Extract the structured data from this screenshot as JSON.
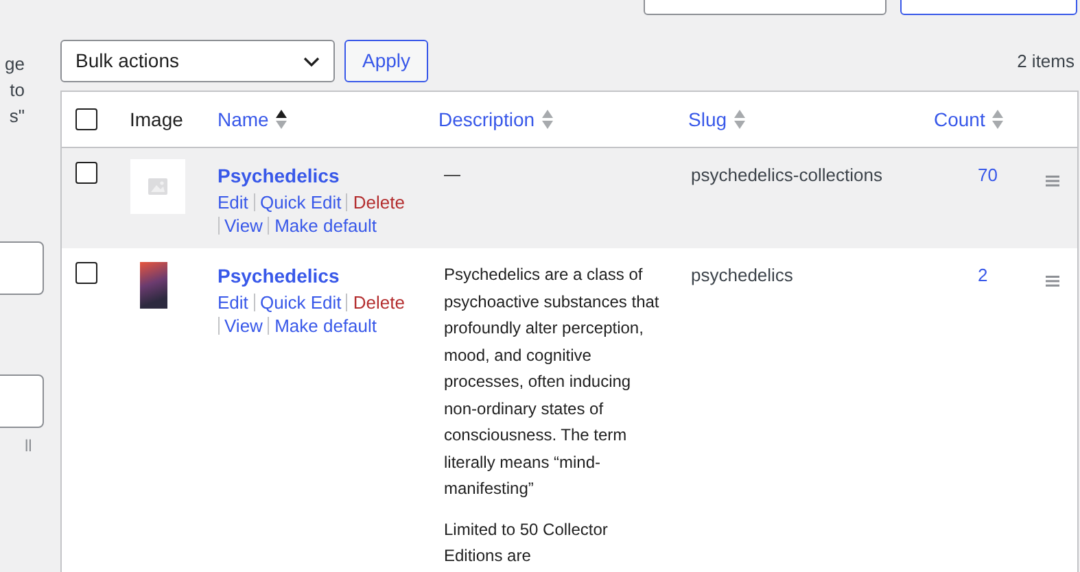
{
  "left_panel": [
    {
      "kind": "text",
      "text": "ge"
    },
    {
      "kind": "text",
      "text": "to"
    },
    {
      "kind": "text",
      "text": "s\""
    },
    {
      "kind": "field"
    },
    {
      "kind": "field"
    },
    {
      "kind": "note",
      "text": "ll"
    }
  ],
  "top_controls": [
    {
      "kind": "field"
    },
    {
      "kind": "button"
    }
  ],
  "toolbar": {
    "bulk_actions": "Bulk actions",
    "apply": "Apply",
    "item_count": "2 items"
  },
  "table": {
    "columns": [
      {
        "kind": "checkbox",
        "checked": false
      },
      {
        "kind": "plain",
        "label": "Image"
      },
      {
        "kind": "sortable",
        "label": "Name",
        "sorted": true
      },
      {
        "kind": "sortable",
        "label": "Description",
        "sorted": false
      },
      {
        "kind": "sortable",
        "label": "Slug",
        "sorted": false
      },
      {
        "kind": "sortable",
        "label": "Count",
        "sorted": false
      },
      {
        "kind": "blank"
      }
    ],
    "rows": [
      {
        "checked": false,
        "highlighted": true,
        "kind": "placeholder",
        "name": "Psychedelics",
        "actions": [
          {
            "label": "Edit",
            "kind": "link"
          },
          {
            "label": "Quick Edit",
            "kind": "link"
          },
          {
            "label": "Delete",
            "kind": "danger"
          },
          {
            "label": "View",
            "kind": "link"
          },
          {
            "label": "Make default",
            "kind": "link"
          }
        ],
        "description": [
          "—"
        ],
        "slug": "psychedelics-collections",
        "count": "70"
      },
      {
        "checked": false,
        "highlighted": false,
        "kind": "photo",
        "name": "Psychedelics",
        "actions": [
          {
            "label": "Edit",
            "kind": "link"
          },
          {
            "label": "Quick Edit",
            "kind": "link"
          },
          {
            "label": "Delete",
            "kind": "danger"
          },
          {
            "label": "View",
            "kind": "link"
          },
          {
            "label": "Make default",
            "kind": "link"
          }
        ],
        "description": [
          "Psychedelics are a class of psychoactive substances that profoundly alter perception, mood, and cognitive processes, often inducing non-ordinary states of consciousness. The term literally means “mind-manifesting”",
          "Limited to 50 Collector Editions are"
        ],
        "slug": "psychedelics",
        "count": "2"
      }
    ]
  }
}
